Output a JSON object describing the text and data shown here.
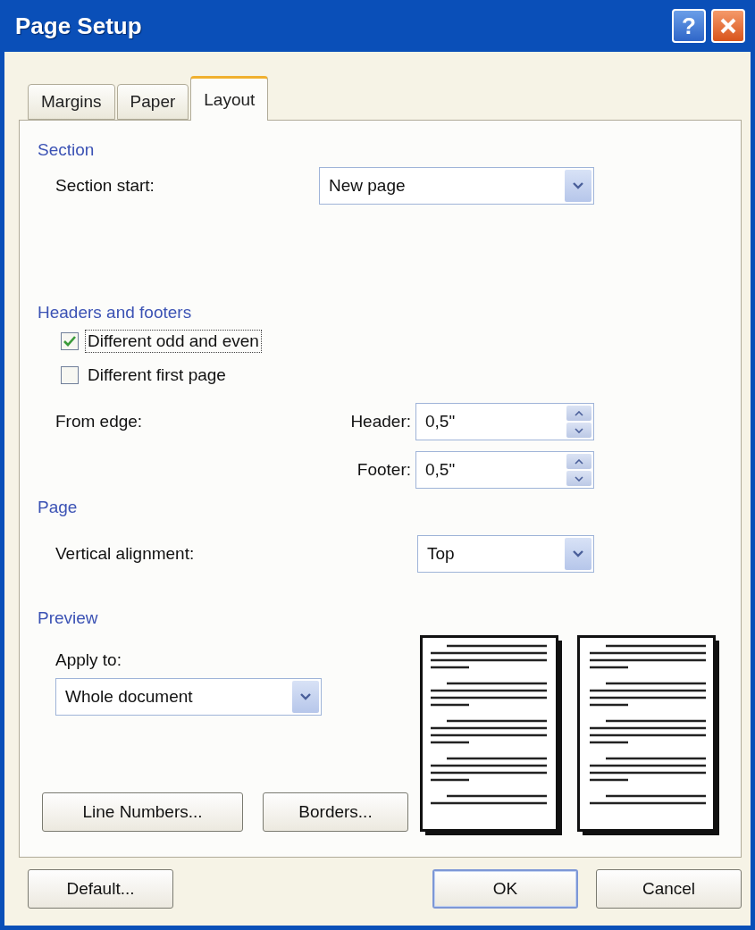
{
  "window": {
    "title": "Page Setup",
    "help_label": "?"
  },
  "tabs": [
    {
      "label": "Margins",
      "selected": false
    },
    {
      "label": "Paper",
      "selected": false
    },
    {
      "label": "Layout",
      "selected": true
    }
  ],
  "section": {
    "title": "Section",
    "section_start": {
      "label": "Section start:",
      "value": "New page"
    }
  },
  "headers_footers": {
    "title": "Headers and footers",
    "options": [
      {
        "label": "Different odd and even",
        "checked": true,
        "focused": true
      },
      {
        "label": "Different first page",
        "checked": false,
        "focused": false
      }
    ],
    "from_edge": {
      "label": "From edge:",
      "header": {
        "label": "Header:",
        "value": "0,5\""
      },
      "footer": {
        "label": "Footer:",
        "value": "0,5\""
      }
    }
  },
  "page": {
    "title": "Page",
    "vertical_alignment": {
      "label": "Vertical alignment:",
      "value": "Top"
    }
  },
  "preview": {
    "title": "Preview",
    "apply_to": {
      "label": "Apply to:",
      "value": "Whole document"
    },
    "buttons": [
      "Line Numbers...",
      "Borders..."
    ]
  },
  "buttons": [
    {
      "label": "Default...",
      "default": false
    },
    {
      "label": "OK",
      "default": true
    },
    {
      "label": "Cancel",
      "default": false
    }
  ]
}
